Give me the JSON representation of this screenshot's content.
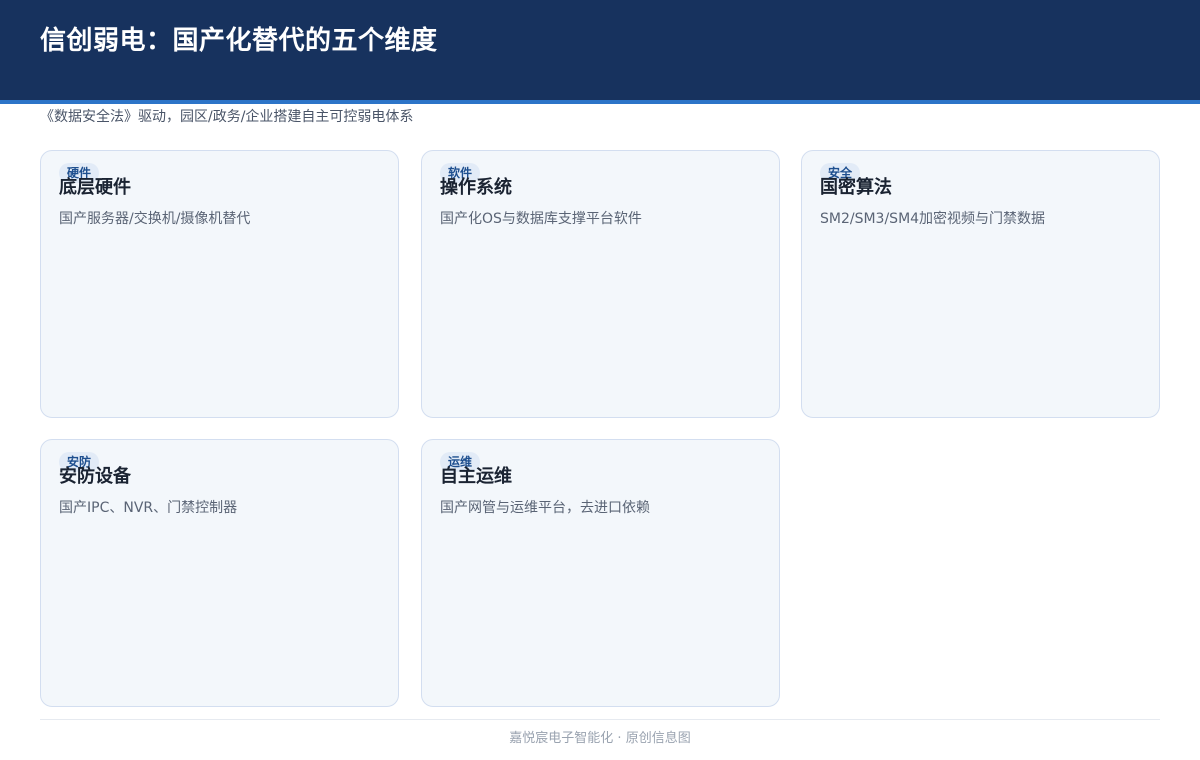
{
  "header": {
    "title": "信创弱电：国产化替代的五个维度",
    "subtitle": "《数据安全法》驱动，园区/政务/企业搭建自主可控弱电体系"
  },
  "cards": [
    {
      "badge": "硬件",
      "title": "底层硬件",
      "desc": "国产服务器/交换机/摄像机替代"
    },
    {
      "badge": "软件",
      "title": "操作系统",
      "desc": "国产化OS与数据库支撑平台软件"
    },
    {
      "badge": "安全",
      "title": "国密算法",
      "desc": "SM2/SM3/SM4加密视频与门禁数据"
    },
    {
      "badge": "安防",
      "title": "安防设备",
      "desc": "国产IPC、NVR、门禁控制器"
    },
    {
      "badge": "运维",
      "title": "自主运维",
      "desc": "国产网管与运维平台，去进口依赖"
    }
  ],
  "footer": {
    "text": "嘉悦宸电子智能化 · 原创信息图"
  },
  "colors": {
    "header_bg": "#17325e",
    "header_accent": "#2c74c8",
    "card_bg": "#f3f7fb",
    "card_border": "#d3def0",
    "badge_text": "#1e4f8f"
  }
}
